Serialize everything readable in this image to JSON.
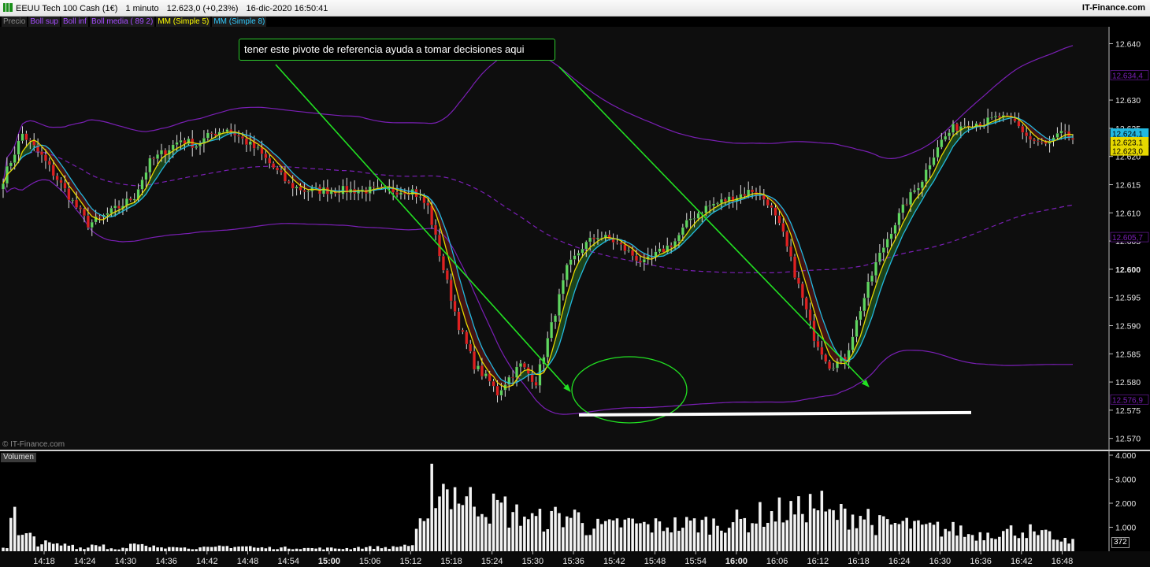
{
  "header": {
    "instrument": "EEUU Tech 100 Cash (1€)",
    "timeframe": "1 minuto",
    "last": "12.623,0 (+0,23%)",
    "datetime": "16-dic-2020 16:50:41",
    "brand": "IT-Finance.com"
  },
  "legend": [
    {
      "label": "Precio",
      "color": "#8a8a8a"
    },
    {
      "label": "Boll sup",
      "color": "#a64dff"
    },
    {
      "label": "Boll inf",
      "color": "#a64dff"
    },
    {
      "label": "Boll media ( 89 2)",
      "color": "#a64dff"
    },
    {
      "label": "MM (Simple 5)",
      "color": "#ffff00"
    },
    {
      "label": "MM (Simple 8)",
      "color": "#33ccff"
    }
  ],
  "annotation": "tener este pivote de referencia ayuda a tomar decisiones aqui",
  "watermark": "© IT-Finance.com",
  "volume_panel": {
    "label": "Volumen",
    "last": "372"
  },
  "colors": {
    "up": "#5fd65f",
    "down": "#e02020",
    "boll": "#7a1fb5",
    "ma5": "#e6d800",
    "ma8": "#22b8e0",
    "arrow": "#22e022"
  },
  "chart_data": {
    "type": "candlestick",
    "y_ticks": [
      "12.570",
      "12.575",
      "12.580",
      "12.585",
      "12.590",
      "12.595",
      "12.600",
      "12.605",
      "12.610",
      "12.615",
      "12.620",
      "12.625",
      "12.630",
      "12.640"
    ],
    "ylim": [
      12568,
      12643
    ],
    "x_ticks": [
      "14:18",
      "14:24",
      "14:30",
      "14:36",
      "14:42",
      "14:48",
      "14:54",
      "15:00",
      "15:06",
      "15:12",
      "15:18",
      "15:24",
      "15:30",
      "15:36",
      "15:42",
      "15:48",
      "15:54",
      "16:00",
      "16:06",
      "16:12",
      "16:18",
      "16:24",
      "16:30",
      "16:36",
      "16:42",
      "16:48"
    ],
    "price_labels": [
      {
        "text": "12.634,4",
        "value": 12634.4,
        "bg": "#000",
        "fg": "#7a1fb5"
      },
      {
        "text": "12.624,1",
        "value": 12624.1,
        "bg": "#22b8e0",
        "fg": "#000"
      },
      {
        "text": "12.623,1",
        "value": 12623.1,
        "bg": "#e6d800",
        "fg": "#000"
      },
      {
        "text": "12.623,0",
        "value": 12623.0,
        "bg": "#e6d800",
        "fg": "#000"
      },
      {
        "text": "12.605,7",
        "value": 12605.7,
        "bg": "#000",
        "fg": "#7a1fb5"
      },
      {
        "text": "12.576,9",
        "value": 12576.9,
        "bg": "#000",
        "fg": "#7a1fb5"
      }
    ],
    "pivot_level": 12574.3,
    "bold_ticks": [
      "12.600"
    ],
    "volume_ticks": [
      "1.000",
      "2.000",
      "3.000",
      "4.000"
    ],
    "volume_ylim": [
      0,
      4000
    ],
    "anchors": [
      [
        0,
        12616
      ],
      [
        5,
        12624
      ],
      [
        10,
        12620
      ],
      [
        14,
        12616
      ],
      [
        18,
        12612
      ],
      [
        22,
        12608
      ],
      [
        25,
        12609
      ],
      [
        30,
        12611
      ],
      [
        34,
        12613
      ],
      [
        38,
        12619
      ],
      [
        42,
        12621
      ],
      [
        46,
        12623
      ],
      [
        50,
        12622
      ],
      [
        54,
        12624
      ],
      [
        58,
        12625
      ],
      [
        62,
        12623
      ],
      [
        66,
        12621
      ],
      [
        70,
        12618
      ],
      [
        74,
        12615
      ],
      [
        78,
        12614
      ],
      [
        82,
        12614
      ],
      [
        86,
        12614
      ],
      [
        90,
        12614
      ],
      [
        94,
        12614
      ],
      [
        98,
        12614
      ],
      [
        102,
        12614
      ],
      [
        106,
        12614
      ],
      [
        110,
        12611
      ],
      [
        114,
        12600
      ],
      [
        118,
        12590
      ],
      [
        122,
        12583
      ],
      [
        126,
        12580
      ],
      [
        128,
        12578
      ],
      [
        130,
        12580
      ],
      [
        134,
        12583
      ],
      [
        138,
        12580
      ],
      [
        142,
        12590
      ],
      [
        146,
        12600
      ],
      [
        150,
        12604
      ],
      [
        154,
        12606
      ],
      [
        158,
        12605
      ],
      [
        162,
        12603
      ],
      [
        166,
        12601
      ],
      [
        170,
        12603
      ],
      [
        174,
        12605
      ],
      [
        178,
        12609
      ],
      [
        182,
        12611
      ],
      [
        186,
        12612
      ],
      [
        190,
        12613
      ],
      [
        194,
        12614
      ],
      [
        198,
        12612
      ],
      [
        202,
        12606
      ],
      [
        206,
        12597
      ],
      [
        210,
        12588
      ],
      [
        214,
        12583
      ],
      [
        218,
        12584
      ],
      [
        222,
        12593
      ],
      [
        226,
        12601
      ],
      [
        230,
        12607
      ],
      [
        234,
        12612
      ],
      [
        238,
        12616
      ],
      [
        242,
        12622
      ],
      [
        246,
        12625
      ],
      [
        250,
        12626
      ],
      [
        254,
        12626
      ],
      [
        258,
        12627
      ],
      [
        262,
        12626
      ],
      [
        266,
        12623
      ],
      [
        270,
        12622
      ],
      [
        274,
        12624
      ],
      [
        277,
        12623
      ]
    ],
    "volumes": [
      {
        "from": 0,
        "to": 1,
        "level": 180
      },
      {
        "from": 2,
        "to": 3,
        "level": 1500
      },
      {
        "from": 4,
        "to": 8,
        "level": 600
      },
      {
        "from": 9,
        "to": 12,
        "level": 330
      },
      {
        "from": 13,
        "to": 18,
        "level": 260
      },
      {
        "from": 19,
        "to": 22,
        "level": 150
      },
      {
        "from": 23,
        "to": 26,
        "level": 280
      },
      {
        "from": 27,
        "to": 32,
        "level": 120
      },
      {
        "from": 33,
        "to": 36,
        "level": 250
      },
      {
        "from": 37,
        "to": 42,
        "level": 180
      },
      {
        "from": 43,
        "to": 45,
        "level": 260
      },
      {
        "from": 46,
        "to": 55,
        "level": 140
      },
      {
        "from": 56,
        "to": 64,
        "level": 200
      },
      {
        "from": 65,
        "to": 78,
        "level": 140
      },
      {
        "from": 79,
        "to": 90,
        "level": 120
      },
      {
        "from": 91,
        "to": 102,
        "level": 160
      },
      {
        "from": 103,
        "to": 106,
        "level": 250
      },
      {
        "from": 107,
        "to": 110,
        "level": 1000
      },
      {
        "from": 111,
        "to": 114,
        "level": 2800
      },
      {
        "from": 115,
        "to": 118,
        "level": 2500
      },
      {
        "from": 119,
        "to": 124,
        "level": 2100
      },
      {
        "from": 125,
        "to": 130,
        "level": 1800
      },
      {
        "from": 131,
        "to": 136,
        "level": 1500
      },
      {
        "from": 137,
        "to": 142,
        "level": 1300
      },
      {
        "from": 143,
        "to": 150,
        "level": 1450
      },
      {
        "from": 151,
        "to": 158,
        "level": 1000
      },
      {
        "from": 159,
        "to": 164,
        "level": 1150
      },
      {
        "from": 165,
        "to": 170,
        "level": 1050
      },
      {
        "from": 171,
        "to": 178,
        "level": 1100
      },
      {
        "from": 179,
        "to": 186,
        "level": 1150
      },
      {
        "from": 187,
        "to": 194,
        "level": 1250
      },
      {
        "from": 195,
        "to": 200,
        "level": 1500
      },
      {
        "from": 201,
        "to": 206,
        "level": 1650
      },
      {
        "from": 207,
        "to": 212,
        "level": 1900
      },
      {
        "from": 213,
        "to": 218,
        "level": 1500
      },
      {
        "from": 219,
        "to": 224,
        "level": 1500
      },
      {
        "from": 225,
        "to": 230,
        "level": 1100
      },
      {
        "from": 231,
        "to": 236,
        "level": 1100
      },
      {
        "from": 237,
        "to": 242,
        "level": 950
      },
      {
        "from": 243,
        "to": 248,
        "level": 900
      },
      {
        "from": 249,
        "to": 254,
        "level": 700
      },
      {
        "from": 255,
        "to": 260,
        "level": 800
      },
      {
        "from": 261,
        "to": 266,
        "level": 850
      },
      {
        "from": 267,
        "to": 272,
        "level": 650
      },
      {
        "from": 273,
        "to": 277,
        "level": 400
      }
    ]
  }
}
